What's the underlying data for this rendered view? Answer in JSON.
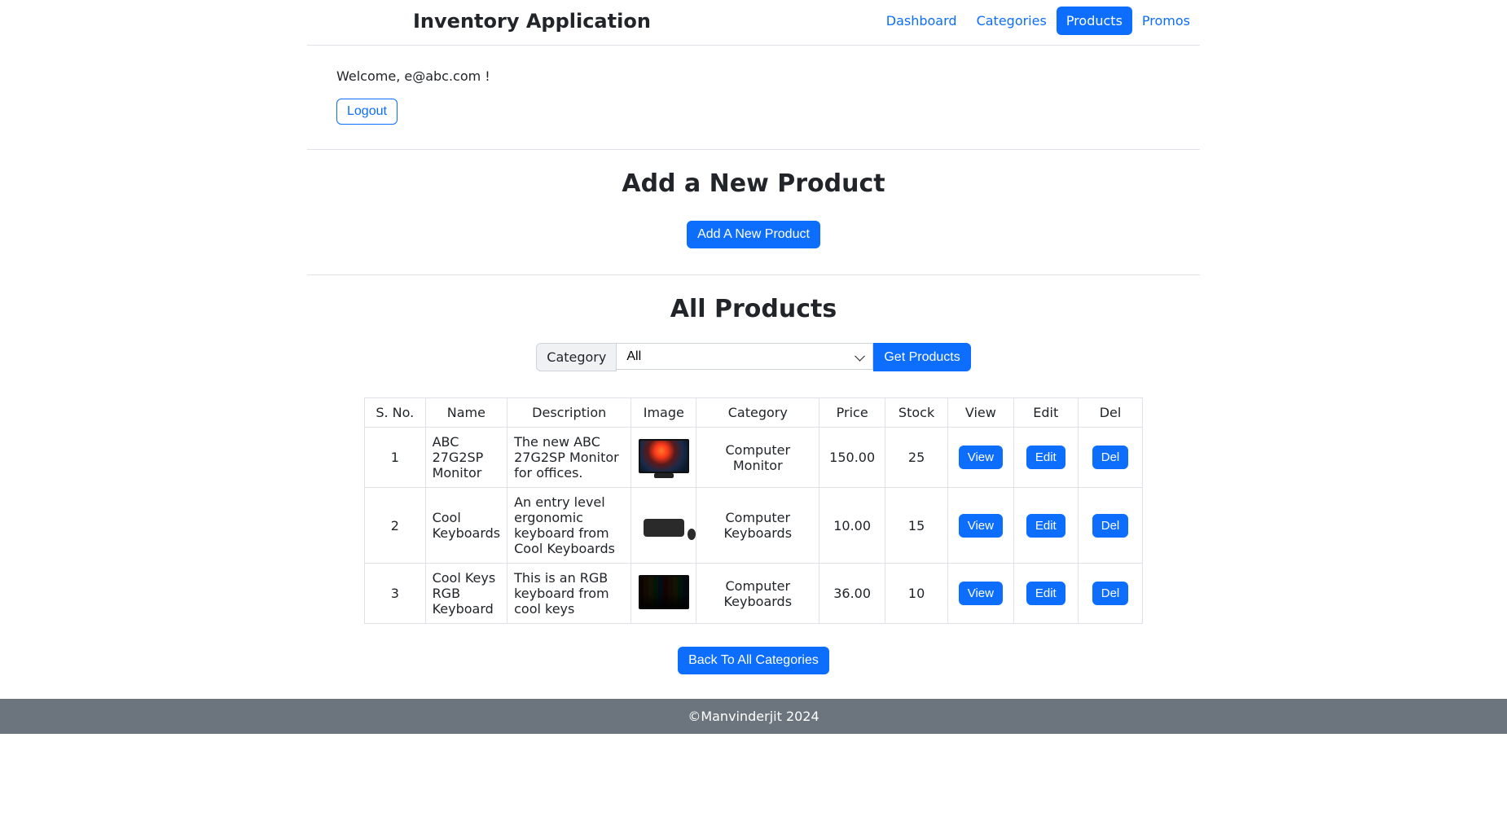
{
  "nav": {
    "brand": "Inventory Application",
    "links": [
      {
        "label": "Dashboard",
        "active": false
      },
      {
        "label": "Categories",
        "active": false
      },
      {
        "label": "Products",
        "active": true
      },
      {
        "label": "Promos",
        "active": false
      }
    ]
  },
  "welcome": {
    "text": "Welcome, e@abc.com !",
    "logout_label": "Logout"
  },
  "add_section": {
    "heading": "Add a New Product",
    "button_label": "Add A New Product"
  },
  "list_section": {
    "heading": "All Products",
    "filter_label": "Category",
    "selected_option": "All",
    "get_button_label": "Get Products"
  },
  "table": {
    "headers": {
      "sno": "S. No.",
      "name": "Name",
      "description": "Description",
      "image": "Image",
      "category": "Category",
      "price": "Price",
      "stock": "Stock",
      "view": "View",
      "edit": "Edit",
      "del": "Del"
    },
    "rows": [
      {
        "sno": "1",
        "name": "ABC 27G2SP Monitor",
        "description": "The new ABC 27G2SP Monitor for offices.",
        "category": "Computer Monitor",
        "price": "150.00",
        "stock": "25",
        "thumb_class": "monitor"
      },
      {
        "sno": "2",
        "name": "Cool Keyboards",
        "description": "An entry level ergonomic keyboard from Cool Keyboards",
        "category": "Computer Keyboards",
        "price": "10.00",
        "stock": "15",
        "thumb_class": "keyboard1"
      },
      {
        "sno": "3",
        "name": "Cool Keys RGB Keyboard",
        "description": "This is an RGB keyboard from cool keys",
        "category": "Computer Keyboards",
        "price": "36.00",
        "stock": "10",
        "thumb_class": "keyboard2"
      }
    ],
    "btn_view": "View",
    "btn_edit": "Edit",
    "btn_del": "Del"
  },
  "back_button_label": "Back To All Categories",
  "footer_text": "©Manvinderjit 2024"
}
